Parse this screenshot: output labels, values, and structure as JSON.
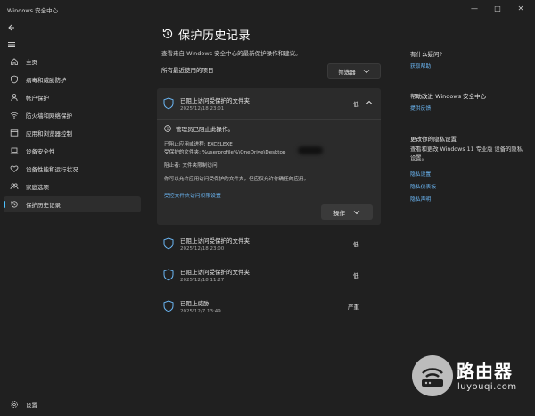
{
  "window": {
    "title": "Windows 安全中心",
    "minimize": "—",
    "maximize": "□",
    "close": "✕"
  },
  "sidebar": {
    "items": [
      {
        "label": "主页",
        "icon": "home-icon"
      },
      {
        "label": "病毒和威胁防护",
        "icon": "shield-icon"
      },
      {
        "label": "帐户保护",
        "icon": "person-icon"
      },
      {
        "label": "防火墙和网络保护",
        "icon": "wifi-icon"
      },
      {
        "label": "应用和浏览器控制",
        "icon": "app-window-icon"
      },
      {
        "label": "设备安全性",
        "icon": "laptop-icon"
      },
      {
        "label": "设备性能和运行状况",
        "icon": "heart-icon"
      },
      {
        "label": "家庭选项",
        "icon": "family-icon"
      },
      {
        "label": "保护历史记录",
        "icon": "history-icon"
      }
    ],
    "settings_label": "设置"
  },
  "main": {
    "title": "保护历史记录",
    "subtitle": "查看来自 Windows 安全中心的最新保护操作和建议。",
    "section_label": "所有最近使用的项目",
    "filter_label": "筛选器",
    "expanded": {
      "title": "已阻止访问受保护的文件夹",
      "date": "2025/12/18 23:01",
      "severity": "低",
      "info": "管理员已阻止此操作。",
      "app_line": "已阻止应用或进程: EXCELEXE",
      "folder_line": "受保护的文件夹: %userprofile%\\OneDrive\\Desktop",
      "blocked_line": "阻止者: 文件夹限制访问",
      "hint_line": "你可以允许应用访问受保护的文件夹，但应仅允许你确任的应用。",
      "link": "受控文件夹访问权限设置",
      "actions_label": "操作"
    },
    "entries": [
      {
        "title": "已阻止访问受保护的文件夹",
        "date": "2025/12/18 23:00",
        "severity": "低"
      },
      {
        "title": "已阻止访问受保护的文件夹",
        "date": "2025/12/18 11:27",
        "severity": "低"
      },
      {
        "title": "已阻止威胁",
        "date": "2025/12/7 13:49",
        "severity": "严重"
      }
    ]
  },
  "right_panel": {
    "help_heading": "有什么疑问?",
    "help_link": "获取帮助",
    "improve_heading": "帮助改进 Windows 安全中心",
    "improve_link": "提供反馈",
    "privacy_heading": "更改你的隐私设置",
    "privacy_text": "查看和更改 Windows 11 专业版 设备的隐私设置。",
    "privacy_links": [
      "隐私设置",
      "隐私仪表板",
      "隐私声明"
    ]
  },
  "watermark": {
    "title": "路由器",
    "subtitle": "luyouqi.com"
  },
  "colors": {
    "background": "#202020",
    "card": "#2b2b2b",
    "accent": "#4cc2ff",
    "link": "#6cb8f6"
  }
}
